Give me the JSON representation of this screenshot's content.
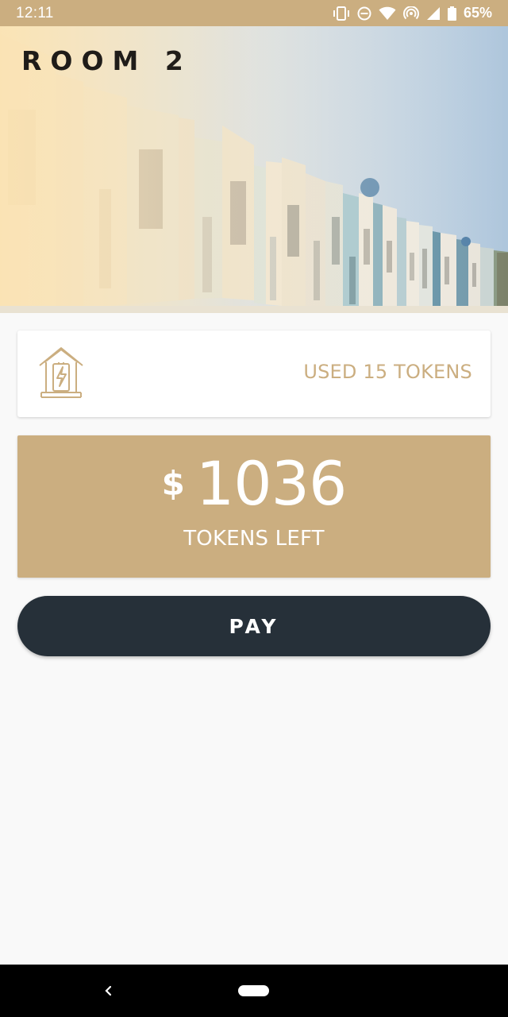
{
  "status_bar": {
    "time": "12:11",
    "battery": "65%",
    "icons": [
      "vibrate-icon",
      "do-not-disturb-icon",
      "wifi-icon",
      "hotspot-icon",
      "signal-icon",
      "battery-icon"
    ]
  },
  "hero": {
    "title": "ROOM 2",
    "image": "row-of-houses-photo"
  },
  "usage": {
    "icon": "electric-house-icon",
    "text": "USED 15 TOKENS"
  },
  "balance": {
    "currency": "$",
    "amount": "1036",
    "label": "TOKENS LEFT"
  },
  "actions": {
    "pay_label": "PAY"
  },
  "colors": {
    "accent": "#cbae80",
    "button": "#263039",
    "background": "#f9f9f9"
  },
  "nav": {
    "icons": [
      "back-icon",
      "home-pill-icon"
    ]
  }
}
